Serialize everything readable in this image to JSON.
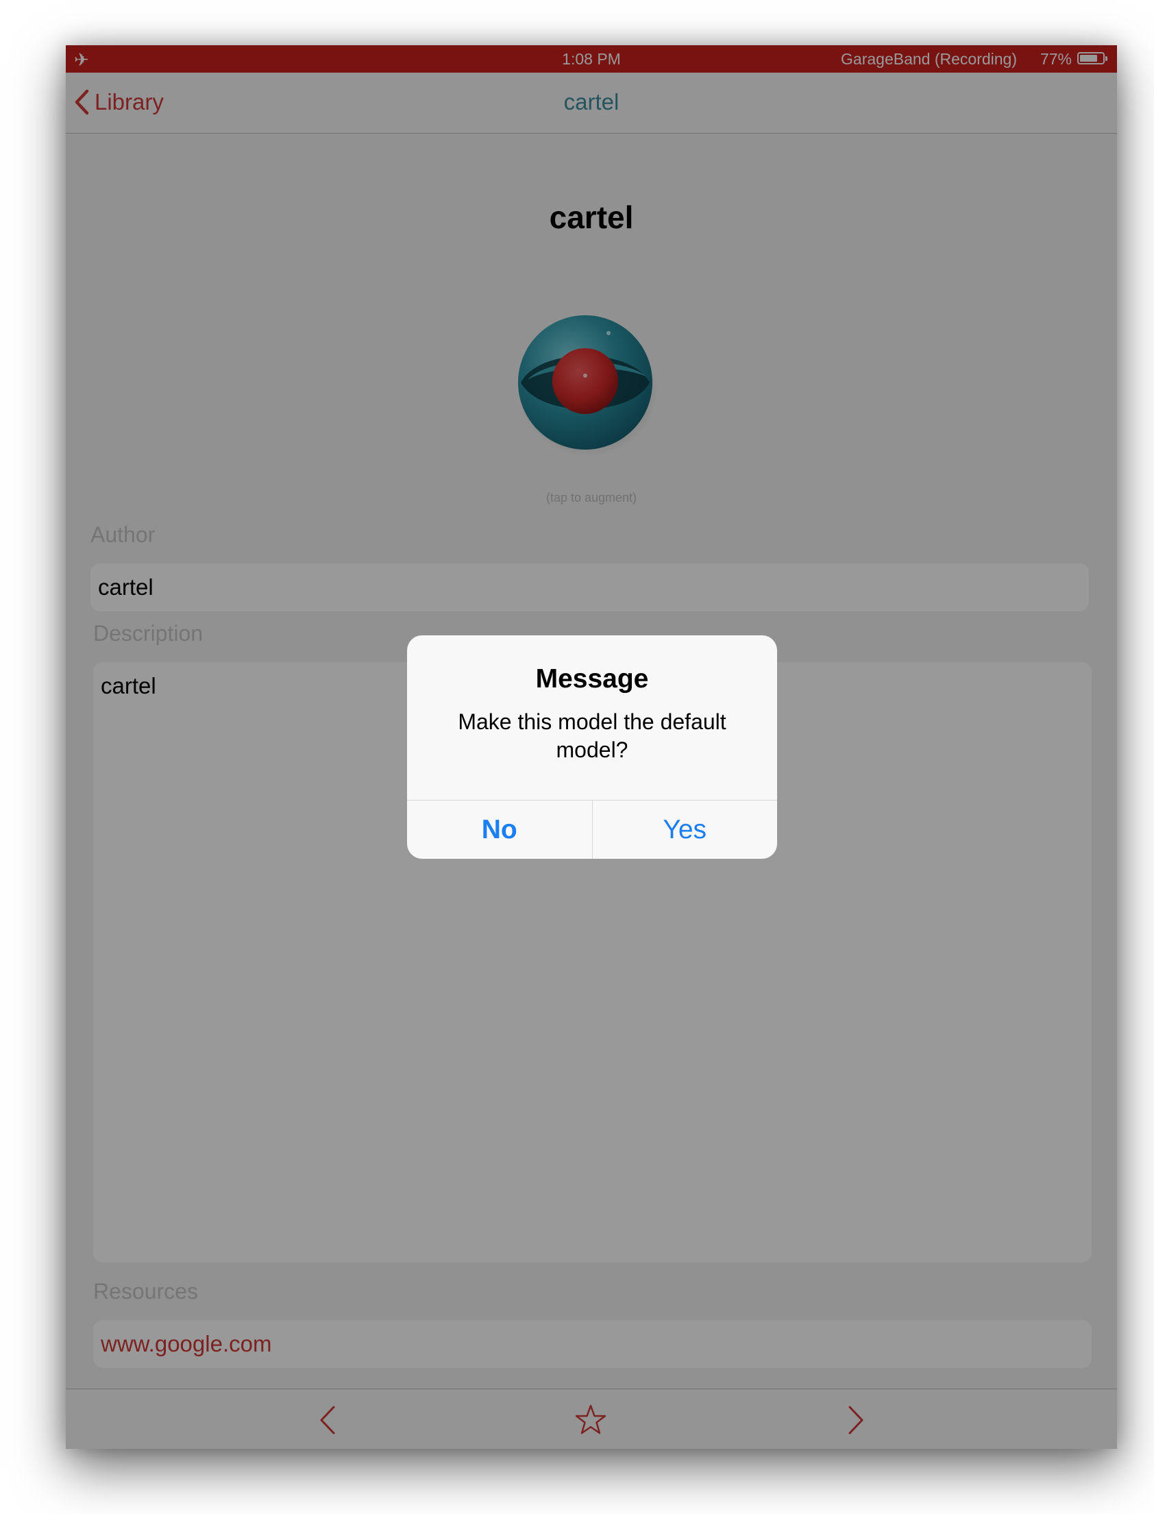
{
  "status_bar": {
    "time": "1:08 PM",
    "app_status": "GarageBand (Recording)",
    "battery": "77%",
    "battery_level": 0.77,
    "airplane_icon": "airplane-icon"
  },
  "nav": {
    "back_label": "Library",
    "title": "cartel"
  },
  "model": {
    "title": "cartel",
    "tap_hint": "(tap to augment)",
    "icon": "eye-model-icon"
  },
  "form": {
    "author_label": "Author",
    "author_value": "cartel",
    "description_label": "Description",
    "description_value": "cartel",
    "resources_label": "Resources",
    "resources_value": "www.google.com"
  },
  "toolbar": {
    "prev_icon": "chevron-left-icon",
    "star_icon": "star-icon",
    "next_icon": "chevron-right-icon"
  },
  "alert": {
    "title": "Message",
    "message": "Make this model the default model?",
    "no_label": "No",
    "yes_label": "Yes"
  },
  "colors": {
    "status_bar": "#c9201f",
    "accent_red": "#cf3b3a",
    "nav_title_teal": "#3c8c9f",
    "alert_button_blue": "#1a7ef5"
  }
}
